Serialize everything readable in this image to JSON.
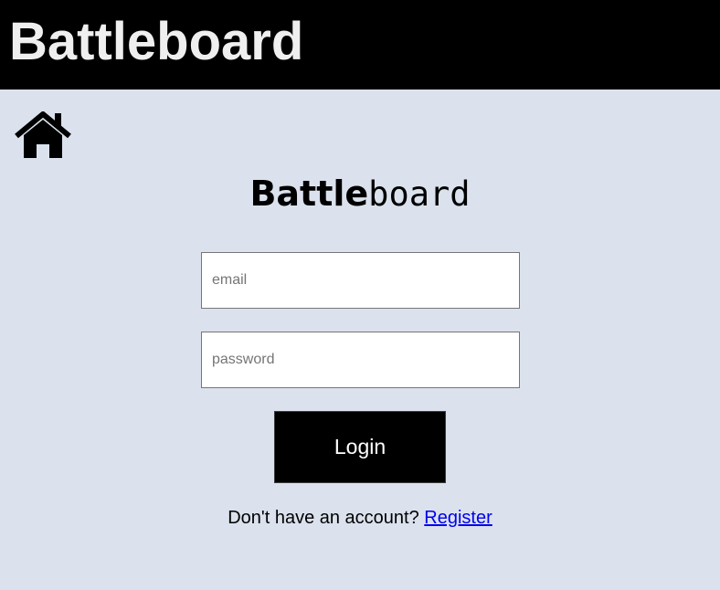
{
  "header": {
    "title": "Battleboard"
  },
  "home": {
    "icon": "home-icon"
  },
  "logo": {
    "bold_part": "Battle",
    "mono_part": "board"
  },
  "form": {
    "email_placeholder": "email",
    "email_value": "",
    "password_placeholder": "password",
    "password_value": "",
    "login_label": "Login"
  },
  "register": {
    "prompt": "Don't have an account?",
    "link_label": "Register"
  },
  "colors": {
    "header_bg": "#000000",
    "header_text": "#efefef",
    "page_bg": "#dbe2ed",
    "button_bg": "#000000",
    "button_text": "#ffffff",
    "link": "#0000ee"
  }
}
